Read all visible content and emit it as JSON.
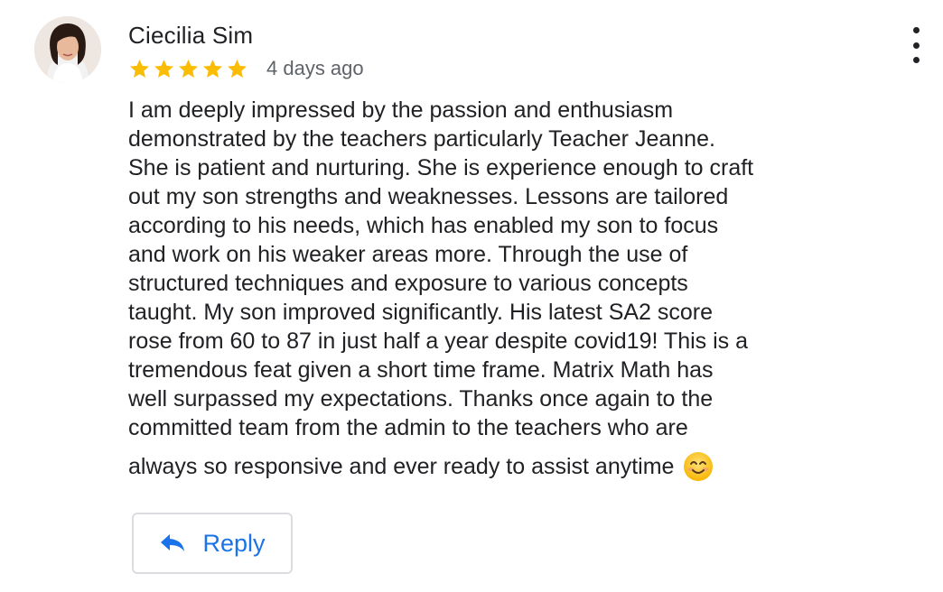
{
  "review": {
    "author": "Ciecilia Sim",
    "rating": 5,
    "date": "4 days ago",
    "lines": [
      "I am deeply impressed by the passion and enthusiasm",
      "demonstrated by the teachers particularly Teacher Jeanne.",
      "She is patient and nurturing. She is experience enough to craft",
      "out my son strengths and weaknesses. Lessons are tailored",
      "according to his needs, which has enabled my son to focus",
      "and work on his weaker areas more. Through the use of",
      "structured techniques and exposure to various concepts",
      "taught. My son improved significantly. His latest SA2 score",
      "rose from 60 to 87 in just half a year despite covid19! This is a",
      "tremendous feat given a short time frame. Matrix Math has",
      "well surpassed my expectations. Thanks once again to the",
      "committed team from the admin to the teachers who are",
      "always so responsive and ever ready to assist anytime"
    ],
    "emoji": "smiling-face-emoji"
  },
  "actions": {
    "reply_label": "Reply",
    "more_icon": "more-vert-icon"
  },
  "colors": {
    "star": "#fbbc04",
    "accent": "#1a73e8",
    "text": "#202124",
    "secondary": "#5f6368"
  }
}
